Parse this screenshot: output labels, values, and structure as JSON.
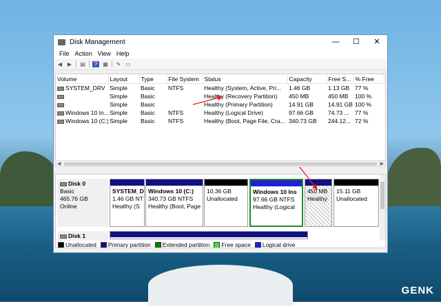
{
  "window": {
    "title": "Disk Management",
    "min": "—",
    "max": "☐",
    "close": "✕"
  },
  "menu": [
    "File",
    "Action",
    "View",
    "Help"
  ],
  "toolbar": [
    "back-icon",
    "forward-icon",
    "sep",
    "list-icon",
    "sep",
    "help-icon",
    "properties-icon",
    "sep",
    "refresh-icon",
    "view-icon"
  ],
  "columns": [
    "Volume",
    "Layout",
    "Type",
    "File System",
    "Status",
    "Capacity",
    "Free S...",
    "% Free"
  ],
  "volumes": [
    [
      "SYSTEM_DRV",
      "Simple",
      "Basic",
      "NTFS",
      "Healthy (System, Active, Pri...",
      "1.46 GB",
      "1.13 GB",
      "77 %"
    ],
    [
      "",
      "Simple",
      "Basic",
      "",
      "Healthy (Recovery Partition)",
      "450 MB",
      "450 MB",
      "100 %"
    ],
    [
      "",
      "Simple",
      "Basic",
      "",
      "Healthy (Primary Partition)",
      "14.91 GB",
      "14.91 GB",
      "100 %"
    ],
    [
      "Windows 10 In...",
      "Simple",
      "Basic",
      "NTFS",
      "Healthy (Logical Drive)",
      "97.66 GB",
      "74.73 ...",
      "77 %"
    ],
    [
      "Windows 10 (C:)",
      "Simple",
      "Basic",
      "NTFS",
      "Healthy (Boot, Page File, Cra...",
      "340.73 GB",
      "244.12...",
      "72 %"
    ]
  ],
  "disk0": {
    "name": "Disk 0",
    "type": "Basic",
    "size": "465.76 GB",
    "state": "Online",
    "partitions": [
      {
        "title": "SYSTEM_D",
        "size": "1.46 GB NT",
        "status": "Healthy (S",
        "color": "#101080"
      },
      {
        "title": "Windows 10  (C:)",
        "size": "340.73 GB NTFS",
        "status": "Healthy (Boot, Page",
        "color": "#101080"
      },
      {
        "title": "",
        "size": "10.36 GB",
        "status": "Unallocated",
        "color": "#000000"
      },
      {
        "title": "Windows 10 Ins",
        "size": "97.66 GB NTFS",
        "status": "Healthy (Logical",
        "color": "#2020d0"
      },
      {
        "title": "",
        "size": "450 MB",
        "status": "Healthy",
        "color": "#101080"
      },
      {
        "title": "",
        "size": "15.11 GB",
        "status": "Unallocated",
        "color": "#000000"
      }
    ]
  },
  "disk1": {
    "name": "Disk 1"
  },
  "legend": [
    {
      "label": "Unallocated",
      "color": "#000000"
    },
    {
      "label": "Primary partition",
      "color": "#101080"
    },
    {
      "label": "Extended partition",
      "color": "#008000"
    },
    {
      "label": "Free space",
      "color": "#40e040"
    },
    {
      "label": "Logical drive",
      "color": "#2020d0"
    }
  ],
  "brand": "GENK",
  "arrow_color": "#e02020"
}
